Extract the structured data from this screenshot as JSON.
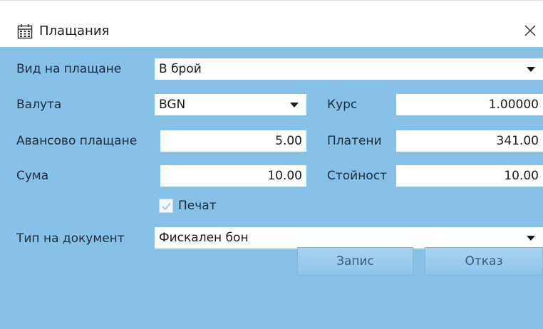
{
  "window": {
    "title": "Плащания",
    "icon": "calendar-grid-icon",
    "close_icon": "close-icon"
  },
  "form": {
    "payment_type": {
      "label": "Вид на плащане",
      "value": "В брой"
    },
    "currency": {
      "label": "Валута",
      "value": "BGN"
    },
    "rate": {
      "label": "Курс",
      "value": "1.00000"
    },
    "advance": {
      "label": "Авансово плащане",
      "value": "5.00"
    },
    "paid": {
      "label": "Платени",
      "value": "341.00"
    },
    "sum": {
      "label": "Сума",
      "value": "10.00"
    },
    "amount": {
      "label": "Стойност",
      "value": "10.00"
    },
    "print": {
      "label": "Печат",
      "checked": true
    },
    "doc_type": {
      "label": "Тип на документ",
      "value": "Фискален бон"
    }
  },
  "buttons": {
    "save": "Запис",
    "cancel": "Отказ"
  },
  "colors": {
    "panel": "#87c1e8",
    "button": "#9ccdee",
    "text": "#1d2c3a"
  }
}
